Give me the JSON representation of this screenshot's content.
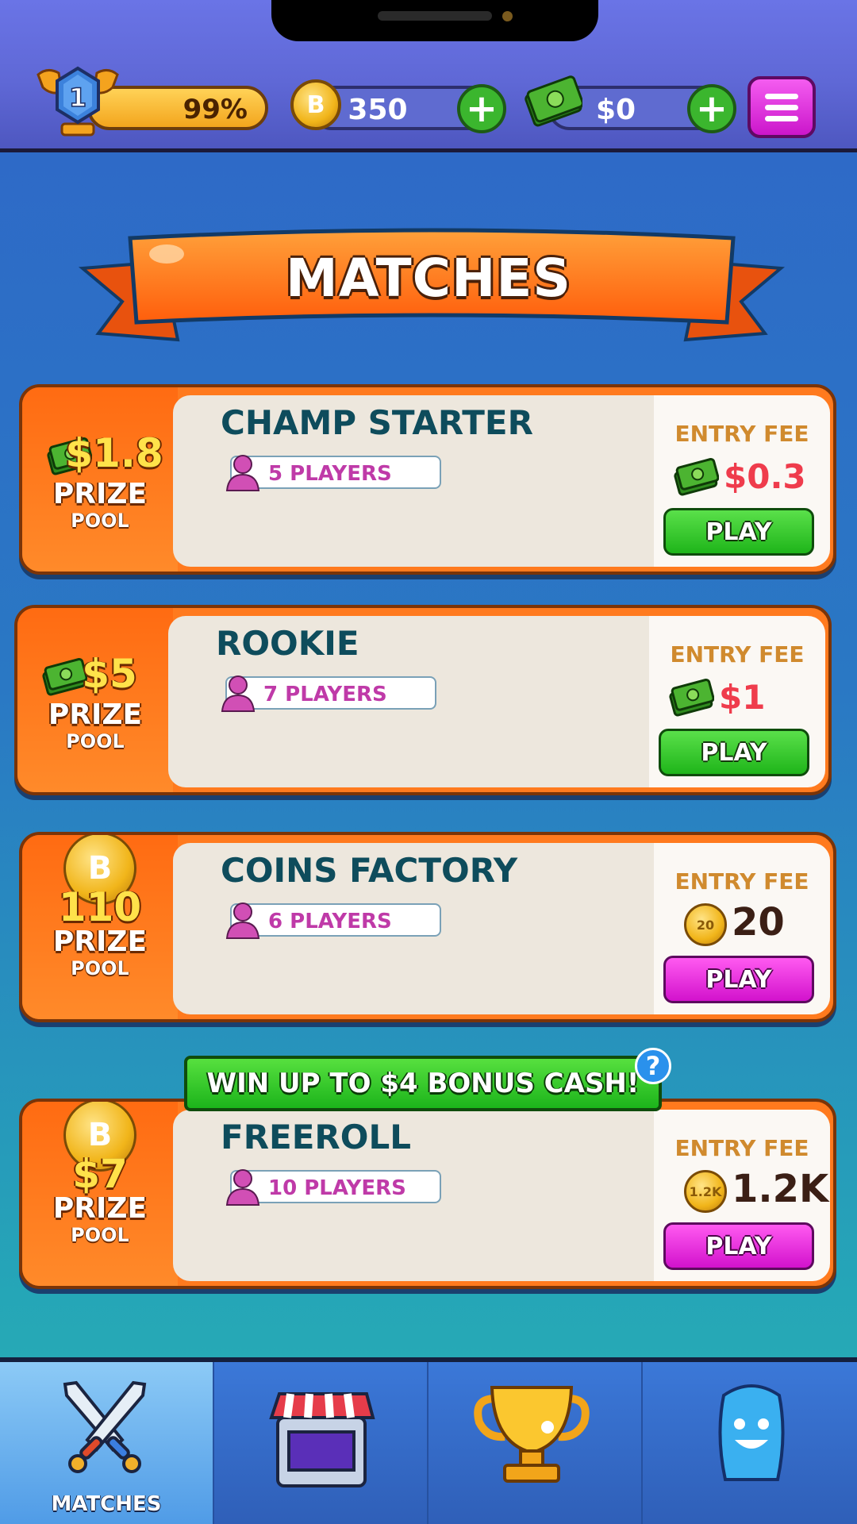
{
  "top_bar": {
    "level": "1",
    "xp_percent": "99%",
    "coins": "350",
    "cash": "$0",
    "coin_icon_letter": "B"
  },
  "banner_title": "MATCHES",
  "prize_word": "PRIZE",
  "pool_word": "POOL",
  "entry_fee_label": "ENTRY FEE",
  "play_label": "PLAY",
  "matches": [
    {
      "name": "CHAMP STARTER",
      "players": "5 PLAYERS",
      "prize": "$1.8",
      "fee": "$0.3",
      "fee_currency": "cash",
      "play_color": "green"
    },
    {
      "name": "ROOKIE",
      "players": "7 PLAYERS",
      "prize": "$5",
      "fee": "$1",
      "fee_currency": "cash",
      "play_color": "green"
    },
    {
      "name": "COINS FACTORY",
      "players": "6 PLAYERS",
      "prize": "110",
      "fee": "20",
      "fee_currency": "coin",
      "fee_coin_text": "20",
      "play_color": "pink"
    },
    {
      "name": "FREEROLL",
      "players": "10 PLAYERS",
      "prize": "$7",
      "fee": "1.2K",
      "fee_currency": "coin",
      "fee_coin_text": "1.2K",
      "play_color": "pink"
    }
  ],
  "bonus_banner": "WIN UP TO $4 BONUS CASH!",
  "help_symbol": "?",
  "nav": [
    {
      "label": "MATCHES",
      "icon": "crossed-swords-icon",
      "active": true
    },
    {
      "label": "",
      "icon": "shop-icon",
      "active": false
    },
    {
      "label": "",
      "icon": "trophy-icon",
      "active": false
    },
    {
      "label": "",
      "icon": "profile-avatar-icon",
      "active": false
    }
  ]
}
